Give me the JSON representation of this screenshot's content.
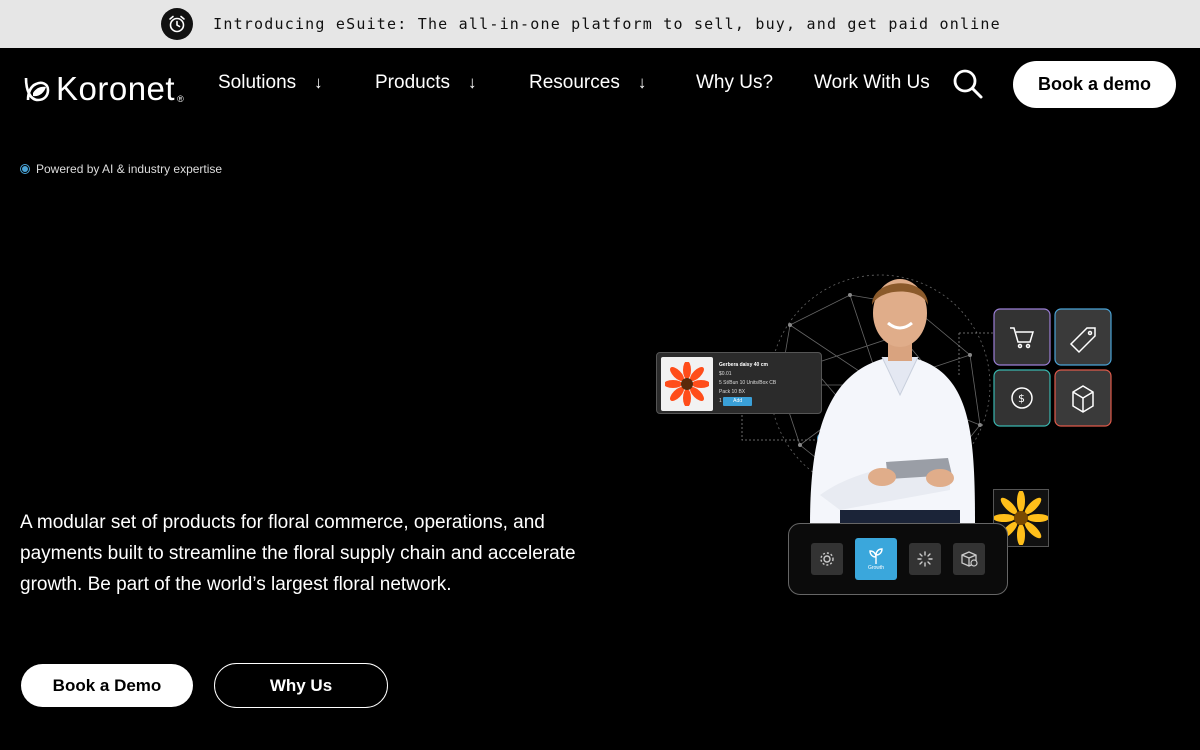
{
  "announcement": {
    "icon": "alarm-clock-icon",
    "text": "Introducing eSuite: The all-in-one platform to sell, buy, and get paid online"
  },
  "nav": {
    "logo_text": "Koronet",
    "logo_reg": "®",
    "items": [
      {
        "label": "Solutions",
        "has_dropdown": true
      },
      {
        "label": "Products",
        "has_dropdown": true
      },
      {
        "label": "Resources",
        "has_dropdown": true
      },
      {
        "label": "Why Us?",
        "has_dropdown": false
      },
      {
        "label": "Work With Us",
        "has_dropdown": false
      }
    ],
    "dropdown_arrow": "↓",
    "search_icon": "search-icon",
    "cta": "Book a demo"
  },
  "hero": {
    "tag": "Powered by AI & industry expertise",
    "description": "A modular set of products for floral commerce, operations, and payments built to streamline the floral supply chain and accelerate growth. Be part of the world’s largest floral network.",
    "primary_button": "Book a Demo",
    "secondary_button": "Why Us"
  },
  "illustration": {
    "card": {
      "title": "Gerbera daisy 40 cm",
      "sku": "$0.01",
      "details": "5 St/Bun    10 Units/Box    CB",
      "pack": "Pack 10 BX",
      "qty": "1",
      "add_label": "Add"
    },
    "active_tool_label": "Growth",
    "accent": "#3aa7dc"
  },
  "colors": {
    "background": "#000000",
    "announcement_bg": "#e6e6e6",
    "accent": "#4aa3d6"
  }
}
